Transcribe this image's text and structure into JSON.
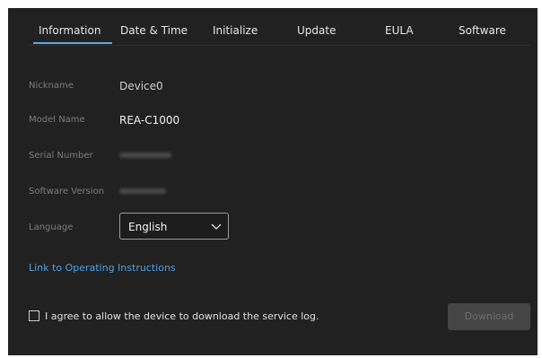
{
  "tabs": [
    {
      "label": "Information",
      "active": true
    },
    {
      "label": "Date & Time",
      "active": false
    },
    {
      "label": "Initialize",
      "active": false
    },
    {
      "label": "Update",
      "active": false
    },
    {
      "label": "EULA",
      "active": false
    },
    {
      "label": "Software",
      "active": false
    }
  ],
  "info": {
    "nickname": {
      "label": "Nickname",
      "value": "Device0"
    },
    "model_name": {
      "label": "Model Name",
      "value": "REA-C1000"
    },
    "serial_number": {
      "label": "Serial Number"
    },
    "software_version": {
      "label": "Software Version"
    }
  },
  "language": {
    "label": "Language",
    "selected": "English",
    "icon": "chevron-down-icon"
  },
  "instructions_link": "Link to Operating Instructions",
  "consent": {
    "checked": false,
    "label": "I agree to allow the device to download the service log."
  },
  "download_button": {
    "label": "Download",
    "enabled": false
  },
  "colors": {
    "panel_background": "#212121",
    "accent": "#5aa9e6",
    "link": "#4aa3e8",
    "button_disabled": "#454545"
  }
}
